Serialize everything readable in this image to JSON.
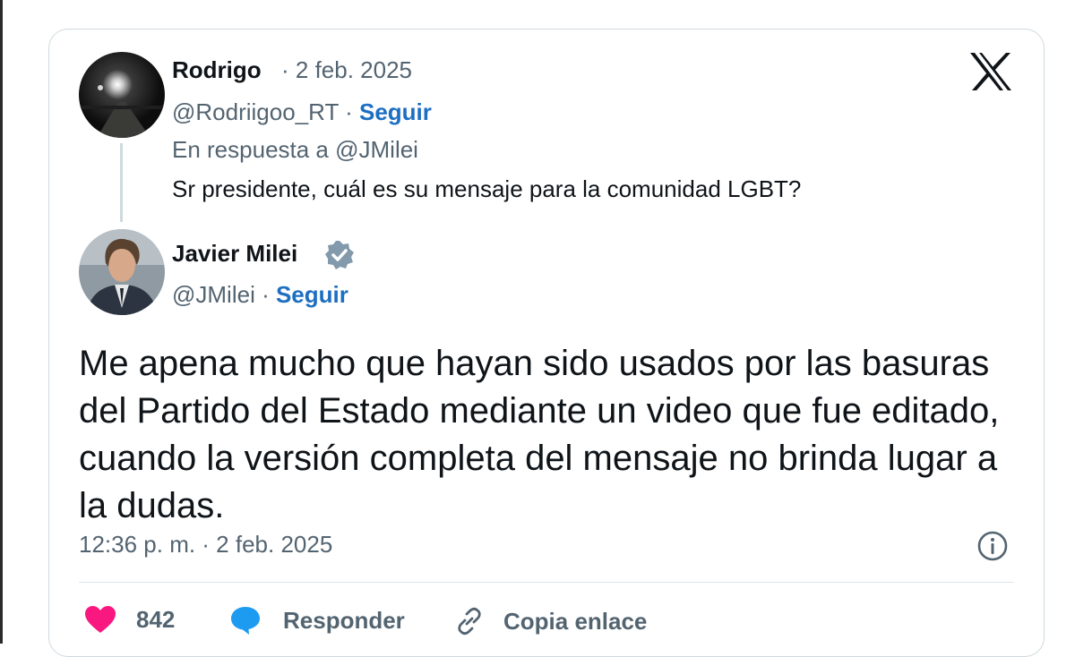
{
  "reply_tweet": {
    "author_name": "Rodrigo",
    "date": "· 2 feb. 2025",
    "handle": "@Rodriigoo_RT ·",
    "follow_label": "Seguir",
    "replying_to": "En respuesta a @JMilei",
    "text": "Sr presidente, cuál es su mensaje para la comunidad LGBT?"
  },
  "main_tweet": {
    "author_name": "Javier Milei",
    "handle": "@JMilei ·",
    "follow_label": "Seguir",
    "text_lines": [
      "Me apena mucho que hayan sido usados por las basuras",
      "del Partido del Estado mediante un video que fue editado,",
      "cuando la versión completa del mensaje no brinda lugar a",
      "la dudas."
    ],
    "timestamp": "12:36 p. m. · 2 feb. 2025"
  },
  "actions": {
    "like_count": "842",
    "reply_label": "Responder",
    "copy_link_label": "Copia enlace"
  },
  "icons": [
    "x-logo-icon",
    "verified-badge-icon",
    "info-icon",
    "heart-icon",
    "reply-bubble-icon",
    "link-icon"
  ],
  "colors": {
    "follow_link": "#1d6fc2",
    "like_heart": "#f91880",
    "reply_bubble": "#1d9bf0",
    "secondary_text": "#536471",
    "verified_badge": "#829aab"
  }
}
